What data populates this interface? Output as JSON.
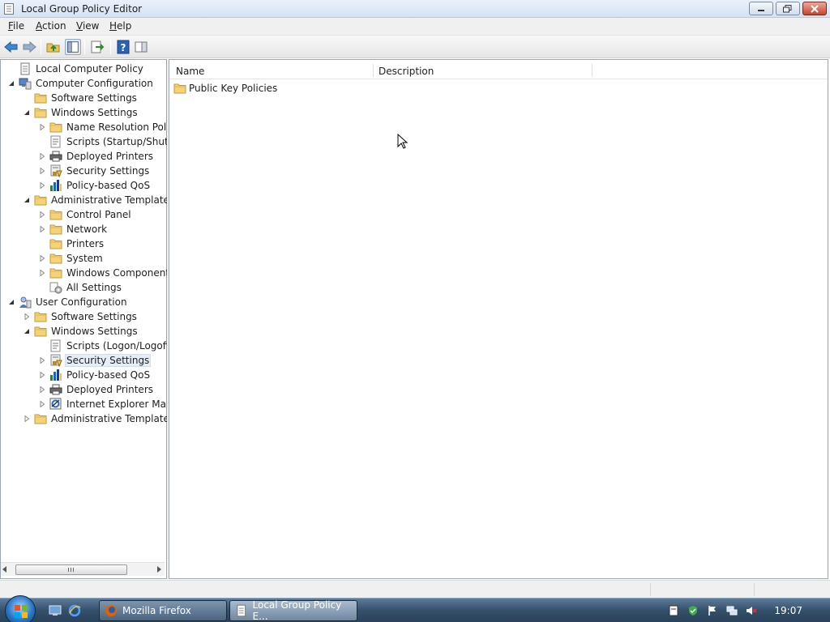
{
  "window": {
    "title": "Local Group Policy Editor"
  },
  "menu": [
    {
      "accel": "F",
      "rest": "ile"
    },
    {
      "accel": "A",
      "rest": "ction"
    },
    {
      "accel": "V",
      "rest": "iew"
    },
    {
      "accel": "H",
      "rest": "elp"
    }
  ],
  "tree": [
    {
      "label": "Local Computer Policy",
      "level": 0,
      "expander": "none",
      "icon": "policy-doc-icon"
    },
    {
      "label": "Computer Configuration",
      "level": 0,
      "expander": "expanded",
      "icon": "computer-icon"
    },
    {
      "label": "Software Settings",
      "level": 1,
      "expander": "none",
      "icon": "folder-icon"
    },
    {
      "label": "Windows Settings",
      "level": 1,
      "expander": "expanded",
      "icon": "folder-icon"
    },
    {
      "label": "Name Resolution Polic",
      "level": 2,
      "expander": "collapsed",
      "icon": "folder-icon"
    },
    {
      "label": "Scripts (Startup/Shutdc",
      "level": 2,
      "expander": "none",
      "icon": "script-icon"
    },
    {
      "label": "Deployed Printers",
      "level": 2,
      "expander": "collapsed",
      "icon": "printer-icon"
    },
    {
      "label": "Security Settings",
      "level": 2,
      "expander": "collapsed",
      "icon": "security-icon"
    },
    {
      "label": "Policy-based QoS",
      "level": 2,
      "expander": "collapsed",
      "icon": "qos-chart-icon"
    },
    {
      "label": "Administrative Templates",
      "level": 1,
      "expander": "expanded",
      "icon": "folder-icon"
    },
    {
      "label": "Control Panel",
      "level": 2,
      "expander": "collapsed",
      "icon": "folder-icon"
    },
    {
      "label": "Network",
      "level": 2,
      "expander": "collapsed",
      "icon": "folder-icon"
    },
    {
      "label": "Printers",
      "level": 2,
      "expander": "none",
      "icon": "folder-icon"
    },
    {
      "label": "System",
      "level": 2,
      "expander": "collapsed",
      "icon": "folder-icon"
    },
    {
      "label": "Windows Components",
      "level": 2,
      "expander": "collapsed",
      "icon": "folder-icon"
    },
    {
      "label": "All Settings",
      "level": 2,
      "expander": "none",
      "icon": "all-settings-icon"
    },
    {
      "label": "User Configuration",
      "level": 0,
      "expander": "expanded",
      "icon": "user-icon"
    },
    {
      "label": "Software Settings",
      "level": 1,
      "expander": "collapsed",
      "icon": "folder-icon"
    },
    {
      "label": "Windows Settings",
      "level": 1,
      "expander": "expanded",
      "icon": "folder-icon"
    },
    {
      "label": "Scripts (Logon/Logoff)",
      "level": 2,
      "expander": "none",
      "icon": "script-icon"
    },
    {
      "label": "Security Settings",
      "level": 2,
      "expander": "collapsed",
      "icon": "security-icon",
      "selected": true
    },
    {
      "label": "Policy-based QoS",
      "level": 2,
      "expander": "collapsed",
      "icon": "qos-chart-icon"
    },
    {
      "label": "Deployed Printers",
      "level": 2,
      "expander": "collapsed",
      "icon": "printer-icon"
    },
    {
      "label": "Internet Explorer Maint",
      "level": 2,
      "expander": "collapsed",
      "icon": "ie-maintenance-icon"
    },
    {
      "label": "Administrative Templates",
      "level": 1,
      "expander": "collapsed",
      "icon": "folder-icon"
    }
  ],
  "list": {
    "columns": [
      "Name",
      "Description"
    ],
    "rows": [
      {
        "name": "Public Key Policies",
        "description": ""
      }
    ]
  },
  "taskbar": {
    "buttons": [
      {
        "label": "Mozilla Firefox",
        "icon": "firefox-icon"
      },
      {
        "label": "Local Group Policy E...",
        "icon": "policy-doc-icon"
      }
    ],
    "clock": "19:07"
  }
}
